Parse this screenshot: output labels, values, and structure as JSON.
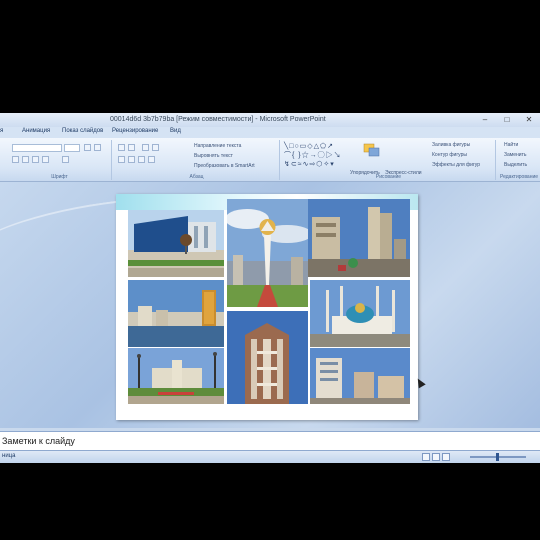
{
  "window": {
    "title": "00014d6d 3b7b79ba [Режим совместимости] - Microsoft PowerPoint",
    "controls": [
      "–",
      "□",
      "✕"
    ]
  },
  "tabs": [
    "я",
    "Анимация",
    "Показ слайдов",
    "Рецензирование",
    "Вид"
  ],
  "ribbon": {
    "groups": [
      "Шрифт",
      "Абзац",
      "Рисование",
      "Редактирование"
    ],
    "paragraph_items": [
      "Направление текста",
      "Выровнять текст",
      "Преобразовать в SmartArt"
    ],
    "drawing_items": [
      "Упорядочить",
      "Экспресс-стили",
      "Заливка фигуры",
      "Контур фигуры",
      "Эффекты для фигур"
    ],
    "editing_items": [
      "Найти",
      "Заменить",
      "Выделить"
    ]
  },
  "notes": {
    "placeholder": "Заметки к слайду"
  },
  "statusbar": {
    "left": "ница"
  },
  "colors": {
    "ribbon": "#d9e6f6",
    "workspace": "#b4cae7",
    "slide_accent": "#8ad6e6"
  },
  "slide_photos": [
    "Bayterek complex",
    "Blue glass office building with globe",
    "Apartment towers with fountains",
    "Residential district by the river with golden tower",
    "Mosque with minarets",
    "Government building with lanterns",
    "Office tower brown facade",
    "Modern residential complex"
  ]
}
